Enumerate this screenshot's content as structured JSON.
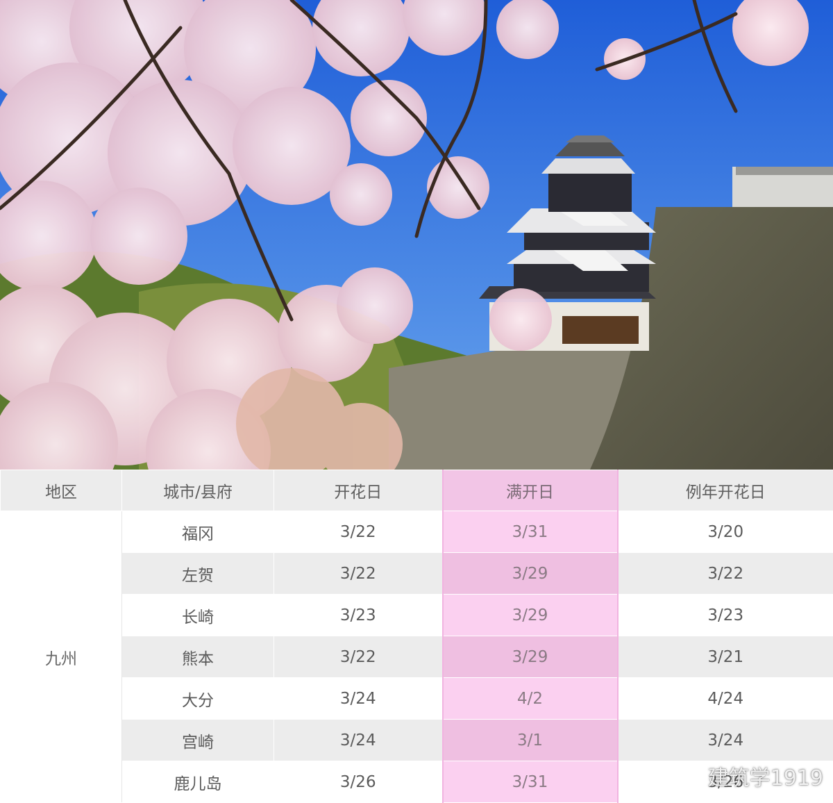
{
  "table": {
    "headers": [
      "地区",
      "城市/县府",
      "开花日",
      "满开日",
      "例年开花日"
    ],
    "region": "九州",
    "rows": [
      [
        "福冈",
        "3/22",
        "3/31",
        "3/20"
      ],
      [
        "左贺",
        "3/22",
        "3/29",
        "3/22"
      ],
      [
        "长崎",
        "3/23",
        "3/29",
        "3/23"
      ],
      [
        "熊本",
        "3/22",
        "3/29",
        "3/21"
      ],
      [
        "大分",
        "3/24",
        "4/2",
        "4/24"
      ],
      [
        "宫崎",
        "3/24",
        "3/1",
        "3/24"
      ],
      [
        "鹿儿岛",
        "3/26",
        "3/31",
        "3/26"
      ]
    ]
  },
  "watermark": {
    "text": "建筑学1919",
    "icon": "weibo-icon"
  },
  "colors": {
    "highlight_header": "#f2c5e6",
    "highlight_cell": "#fbd0f0",
    "header_bg": "#ececec",
    "sky": "#3f7fe0"
  }
}
